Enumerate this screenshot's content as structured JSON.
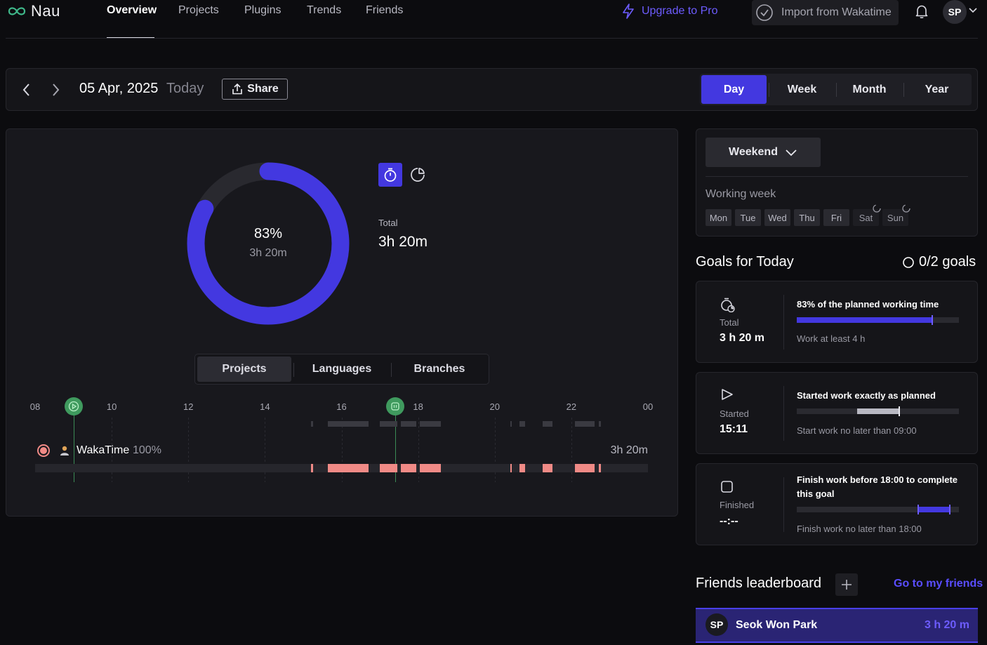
{
  "nav": {
    "logo": "Nau",
    "items": [
      {
        "label": "Overview",
        "active": true
      },
      {
        "label": "Projects",
        "active": false
      },
      {
        "label": "Plugins",
        "active": false
      },
      {
        "label": "Trends",
        "active": false
      },
      {
        "label": "Friends",
        "active": false
      }
    ],
    "upgrade": "Upgrade to Pro",
    "import": "Import from Wakatime",
    "avatar": "SP",
    "accent_color": "#4338e0",
    "icons": [
      "logo-infinity-icon",
      "lightning-icon",
      "check-circle-icon",
      "bell-icon",
      "chevron-down-icon"
    ]
  },
  "datebar": {
    "date": "05 Apr, 2025",
    "today": "Today",
    "share": "Share",
    "periods": [
      {
        "label": "Day",
        "active": true
      },
      {
        "label": "Week",
        "active": false
      },
      {
        "label": "Month",
        "active": false
      },
      {
        "label": "Year",
        "active": false
      }
    ]
  },
  "summary": {
    "percent_value": 83,
    "percent": "83%",
    "time": "3h 20m",
    "total_label": "Total",
    "total_value": "3h 20m",
    "tabs": [
      {
        "label": "Projects",
        "active": true
      },
      {
        "label": "Languages",
        "active": false
      },
      {
        "label": "Branches",
        "active": false
      }
    ]
  },
  "timeline": {
    "hour_labels": [
      "08",
      "10",
      "12",
      "14",
      "16",
      "18",
      "20",
      "22",
      "00"
    ],
    "started_hour": 9.0,
    "now_hour": 17.4,
    "project": {
      "name": "WakaTime",
      "percent": "100%",
      "time": "3h 20m",
      "color": "#f08a86"
    },
    "activity_blocks": [
      [
        15.2,
        15.25
      ],
      [
        15.65,
        16.65
      ],
      [
        16.45,
        16.5
      ],
      [
        16.65,
        16.7
      ],
      [
        17.0,
        17.45
      ],
      [
        17.55,
        17.95
      ],
      [
        18.05,
        18.6
      ],
      [
        20.4,
        20.45
      ],
      [
        20.65,
        20.8
      ],
      [
        21.25,
        21.5
      ],
      [
        22.1,
        22.6
      ],
      [
        22.72,
        22.78
      ]
    ]
  },
  "week": {
    "dropdown": "Weekend",
    "working_week_label": "Working week",
    "days": [
      {
        "label": "Mon",
        "working": true
      },
      {
        "label": "Tue",
        "working": true
      },
      {
        "label": "Wed",
        "working": true
      },
      {
        "label": "Thu",
        "working": true
      },
      {
        "label": "Fri",
        "working": true
      },
      {
        "label": "Sat",
        "working": false
      },
      {
        "label": "Sun",
        "working": false
      }
    ]
  },
  "goals": {
    "title": "Goals for Today",
    "count": "0/2 goals",
    "items": [
      {
        "label": "Total",
        "value": "3 h 20 m",
        "title": "83% of the planned working time",
        "sub": "Work at least 4 h",
        "progress": 0.83
      },
      {
        "label": "Started",
        "value": "15:11",
        "title": "Started work exactly as planned",
        "sub": "Start work no later than 09:00",
        "progress": 0.2
      },
      {
        "label": "Finished",
        "value": "--:--",
        "title": "Finish work before 18:00 to complete this goal",
        "sub": "Finish work no later than 18:00",
        "progress": 0.2
      }
    ]
  },
  "friends": {
    "title": "Friends leaderboard",
    "link": "Go to my friends",
    "rows": [
      {
        "avatar": "SP",
        "name": "Seok Won Park",
        "time": "3 h 20 m"
      }
    ]
  }
}
